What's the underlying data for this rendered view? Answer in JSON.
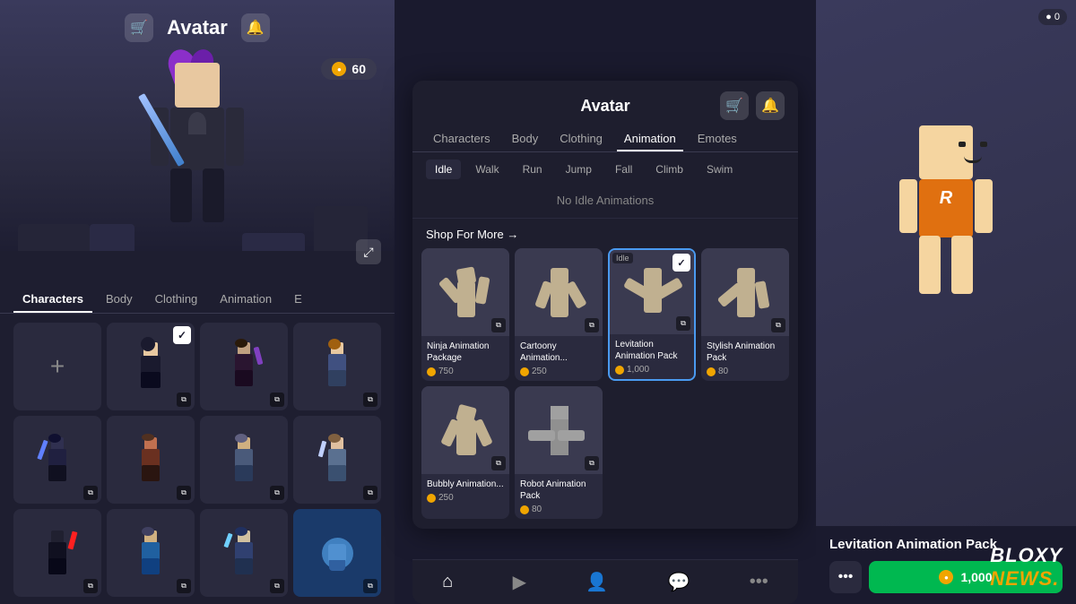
{
  "leftPanel": {
    "title": "Avatar",
    "coins": "60",
    "navTabs": [
      {
        "label": "Characters",
        "active": true
      },
      {
        "label": "Body",
        "active": false
      },
      {
        "label": "Clothing",
        "active": false
      },
      {
        "label": "Animation",
        "active": false
      },
      {
        "label": "E",
        "active": false
      }
    ],
    "characterLabel": "Characters"
  },
  "middlePanel": {
    "title": "Avatar",
    "navTabs": [
      {
        "label": "Characters",
        "active": false
      },
      {
        "label": "Body",
        "active": false
      },
      {
        "label": "Clothing",
        "active": false
      },
      {
        "label": "Animation",
        "active": true
      },
      {
        "label": "Emotes",
        "active": false
      }
    ],
    "animSubTabs": [
      {
        "label": "Idle",
        "active": true
      },
      {
        "label": "Walk",
        "active": false
      },
      {
        "label": "Run",
        "active": false
      },
      {
        "label": "Jump",
        "active": false
      },
      {
        "label": "Fall",
        "active": false
      },
      {
        "label": "Climb",
        "active": false
      },
      {
        "label": "Swim",
        "active": false
      }
    ],
    "noAnimText": "No Idle Animations",
    "shopMoreLabel": "Shop For More →",
    "shopItems": [
      {
        "name": "Ninja Animation Package",
        "price": "750",
        "selected": false,
        "hasCopy": true
      },
      {
        "name": "Cartoony Animation...",
        "price": "250",
        "selected": false,
        "hasCopy": true
      },
      {
        "name": "Levitation Animation Pack",
        "price": "1,000",
        "selected": false,
        "hasCheck": true,
        "hasCopy": true
      },
      {
        "name": "Stylish Animation Pack",
        "price": "80",
        "selected": false,
        "hasCopy": true
      },
      {
        "name": "Bubbly Animation...",
        "price": "250",
        "selected": false,
        "hasCopy": true
      },
      {
        "name": "Robot Animation Pack",
        "price": "80",
        "selected": false,
        "hasCopy": true
      }
    ]
  },
  "rightPanel": {
    "badge": "0",
    "itemName": "Levitation Animation Pack",
    "buyPrice": "1,000"
  },
  "bottomNav": {
    "icons": [
      "home",
      "play",
      "avatar",
      "chat",
      "more"
    ]
  },
  "watermark": {
    "text": "BLOXY",
    "dot": "NEWS."
  }
}
